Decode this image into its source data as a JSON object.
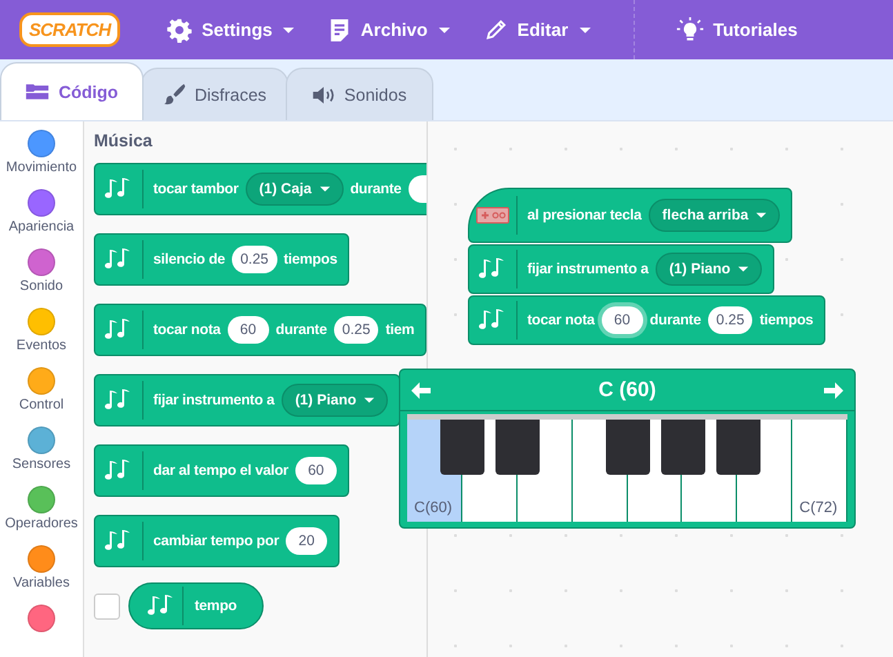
{
  "menu": {
    "logo": "SCRATCH",
    "items": [
      {
        "kind": "settings",
        "label": "Settings",
        "has_menu": true
      },
      {
        "kind": "file",
        "label": "Archivo",
        "has_menu": true
      },
      {
        "kind": "edit",
        "label": "Editar",
        "has_menu": true
      },
      {
        "kind": "tutorials",
        "label": "Tutoriales",
        "has_menu": false
      }
    ]
  },
  "tabs": [
    {
      "kind": "code",
      "label": "Código",
      "selected": true
    },
    {
      "kind": "costumes",
      "label": "Disfraces",
      "selected": false
    },
    {
      "kind": "sounds",
      "label": "Sonidos",
      "selected": false
    }
  ],
  "categories": [
    {
      "label": "Movimiento",
      "color": "#4c97ff"
    },
    {
      "label": "Apariencia",
      "color": "#9966ff"
    },
    {
      "label": "Sonido",
      "color": "#cf63cf"
    },
    {
      "label": "Eventos",
      "color": "#ffbf00"
    },
    {
      "label": "Control",
      "color": "#ffab19"
    },
    {
      "label": "Sensores",
      "color": "#5cb1d6"
    },
    {
      "label": "Operadores",
      "color": "#59c059"
    },
    {
      "label": "Variables",
      "color": "#ff8c1a"
    },
    {
      "color": "#ff6680"
    }
  ],
  "palette": {
    "title": "Música",
    "blocks": [
      {
        "parts": [
          {
            "kind": "text",
            "text": "tocar tambor"
          },
          {
            "kind": "dropdown",
            "text": "(1) Caja"
          },
          {
            "kind": "text",
            "text": "durante"
          },
          {
            "kind": "number"
          }
        ]
      },
      {
        "parts": [
          {
            "kind": "text",
            "text": "silencio de"
          },
          {
            "kind": "number",
            "text": "0.25"
          },
          {
            "kind": "text",
            "text": "tiempos"
          }
        ]
      },
      {
        "parts": [
          {
            "kind": "text",
            "text": "tocar nota"
          },
          {
            "kind": "number",
            "text": "60"
          },
          {
            "kind": "text",
            "text": "durante"
          },
          {
            "kind": "number",
            "text": "0.25"
          },
          {
            "kind": "text",
            "text": "tiem"
          }
        ]
      },
      {
        "parts": [
          {
            "kind": "text",
            "text": "fijar instrumento a"
          },
          {
            "kind": "dropdown",
            "text": "(1) Piano"
          }
        ]
      },
      {
        "parts": [
          {
            "kind": "text",
            "text": "dar al tempo el valor"
          },
          {
            "kind": "number",
            "text": "60"
          }
        ]
      },
      {
        "parts": [
          {
            "kind": "text",
            "text": "cambiar tempo por"
          },
          {
            "kind": "number",
            "text": "20"
          }
        ]
      }
    ],
    "reporter": {
      "label": "tempo",
      "checked": false
    }
  },
  "script": [
    {
      "kind": "hat",
      "parts": [
        {
          "kind": "text",
          "text": "al presionar tecla"
        },
        {
          "kind": "dropdown",
          "text": "flecha arriba"
        }
      ]
    },
    {
      "kind": "music",
      "parts": [
        {
          "kind": "text",
          "text": "fijar instrumento a"
        },
        {
          "kind": "dropdown",
          "text": "(1) Piano"
        }
      ]
    },
    {
      "kind": "music",
      "parts": [
        {
          "kind": "text",
          "text": "tocar nota"
        },
        {
          "kind": "number",
          "text": "60",
          "focused": true
        },
        {
          "kind": "text",
          "text": "durante"
        },
        {
          "kind": "number",
          "text": "0.25"
        },
        {
          "kind": "text",
          "text": "tiempos"
        }
      ]
    }
  ],
  "piano": {
    "note": "C (60)",
    "keys": [
      {
        "label": "C(60)",
        "selected": true,
        "sharp": true
      },
      {
        "selected": false,
        "sharp": true
      },
      {
        "selected": false,
        "sharp": false
      },
      {
        "selected": false,
        "sharp": true
      },
      {
        "selected": false,
        "sharp": true
      },
      {
        "selected": false,
        "sharp": true
      },
      {
        "selected": false,
        "sharp": false
      },
      {
        "label": "C(72)",
        "selected": false,
        "sharp": false
      }
    ]
  }
}
